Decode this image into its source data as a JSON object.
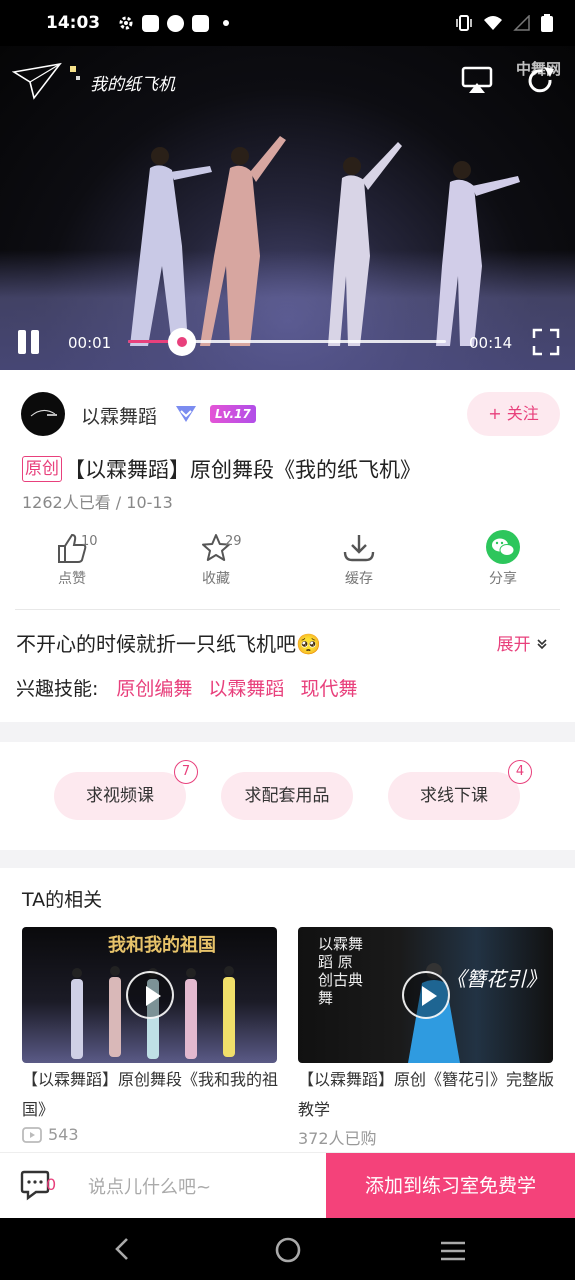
{
  "status_bar": {
    "time": "14:03"
  },
  "video": {
    "overlay_title": "我的纸飞机",
    "brand_mark": "中舞网",
    "current_time": "00:01",
    "total_time": "00:14",
    "progress": 0.17
  },
  "author": {
    "name": "以霖舞蹈",
    "level": "Lv.17",
    "follow_label": "+ 关注"
  },
  "video_info": {
    "tag": "原创",
    "title": "【以霖舞蹈】原创舞段《我的纸飞机》",
    "meta": "1262人已看 / 10-13"
  },
  "actions": [
    {
      "icon": "thumb-up-icon",
      "label": "点赞",
      "count": "10"
    },
    {
      "icon": "star-icon",
      "label": "收藏",
      "count": "29"
    },
    {
      "icon": "download-icon",
      "label": "缓存",
      "count": ""
    },
    {
      "icon": "wechat-icon",
      "label": "分享",
      "count": ""
    }
  ],
  "description": {
    "text": "不开心的时候就折一只纸飞机吧🥺",
    "expand_label": "展开"
  },
  "skills": {
    "label": "兴趣技能:",
    "tags": [
      "原创编舞",
      "以霖舞蹈",
      "现代舞"
    ]
  },
  "requests": [
    {
      "label": "求视频课",
      "count": "7"
    },
    {
      "label": "求配套用品",
      "count": ""
    },
    {
      "label": "求线下课",
      "count": "4"
    }
  ],
  "related": {
    "title": "TA的相关",
    "items": [
      {
        "title": "【以霖舞蹈】原创舞段《我和我的祖国》",
        "meta": "543",
        "thumb_text": "我和我的祖国"
      },
      {
        "title": "【以霖舞蹈】原创《簪花引》完整版教学",
        "meta": "372人已购",
        "thumb_text": "《簪花引》",
        "thumb_side_text": "以霖舞蹈 原创古典舞"
      }
    ]
  },
  "bottom_bar": {
    "comment_count": "0",
    "comment_placeholder": "说点儿什么吧~",
    "cta_label": "添加到练习室免费学"
  },
  "colors": {
    "accent": "#e8407c",
    "cta": "#f4427a",
    "request_bg": "#fde9ef"
  }
}
